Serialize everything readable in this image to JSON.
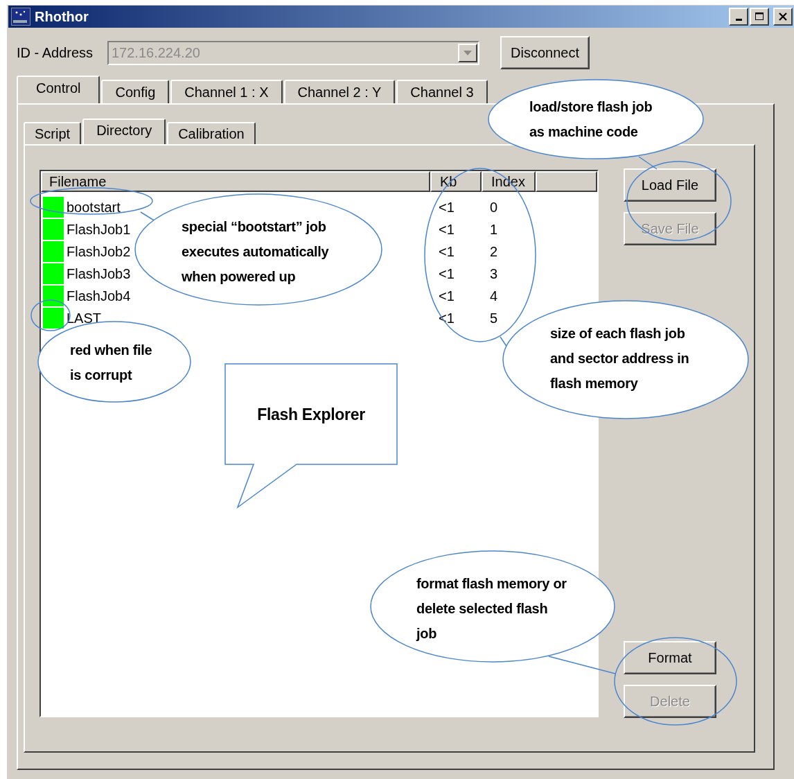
{
  "window": {
    "title": "Rhothor"
  },
  "address": {
    "label": "ID - Address",
    "value": "172.16.224.20",
    "disabled": true
  },
  "disconnect_button": {
    "label": "Disconnect"
  },
  "tabs": [
    {
      "label": "Control",
      "selected": true
    },
    {
      "label": "Config",
      "selected": false
    },
    {
      "label": "Channel 1 : X",
      "selected": false
    },
    {
      "label": "Channel 2 : Y",
      "selected": false
    },
    {
      "label": "Channel 3",
      "selected": false
    }
  ],
  "subtabs": [
    {
      "label": "Script",
      "selected": false
    },
    {
      "label": "Directory",
      "selected": true
    },
    {
      "label": "Calibration",
      "selected": false
    }
  ],
  "table": {
    "columns": [
      "Filename",
      "Kb",
      "Index"
    ],
    "rows": [
      {
        "filename": "bootstart",
        "kb": "<1",
        "index": "0",
        "color": "#00ff00"
      },
      {
        "filename": "FlashJob1",
        "kb": "<1",
        "index": "1",
        "color": "#00ff00"
      },
      {
        "filename": "FlashJob2",
        "kb": "<1",
        "index": "2",
        "color": "#00ff00"
      },
      {
        "filename": "FlashJob3",
        "kb": "<1",
        "index": "3",
        "color": "#00ff00"
      },
      {
        "filename": "FlashJob4",
        "kb": "<1",
        "index": "4",
        "color": "#00ff00"
      },
      {
        "filename": "LAST",
        "kb": "<1",
        "index": "5",
        "color": "#00ff00"
      }
    ]
  },
  "file_buttons": [
    {
      "label": "Load File",
      "disabled": false
    },
    {
      "label": "Save File",
      "disabled": true
    }
  ],
  "job_buttons": [
    {
      "label": "Format",
      "disabled": false
    },
    {
      "label": "Delete",
      "disabled": true
    }
  ],
  "callouts": [
    {
      "kind": "ellipse",
      "lines": [
        "load/store flash job",
        "as machine code"
      ]
    },
    {
      "kind": "ellipse",
      "lines": [
        "special “bootstart” job",
        "executes automatically",
        "when powered up"
      ]
    },
    {
      "kind": "ellipse",
      "lines": [
        "red when file",
        "is corrupt"
      ]
    },
    {
      "kind": "ellipse",
      "lines": [
        "size of each flash job",
        "and sector address in",
        "flash memory"
      ]
    },
    {
      "kind": "speech_bubble",
      "lines": [
        "Flash Explorer"
      ]
    },
    {
      "kind": "ellipse",
      "lines": [
        "format flash memory or",
        "delete selected flash",
        "job"
      ]
    }
  ]
}
